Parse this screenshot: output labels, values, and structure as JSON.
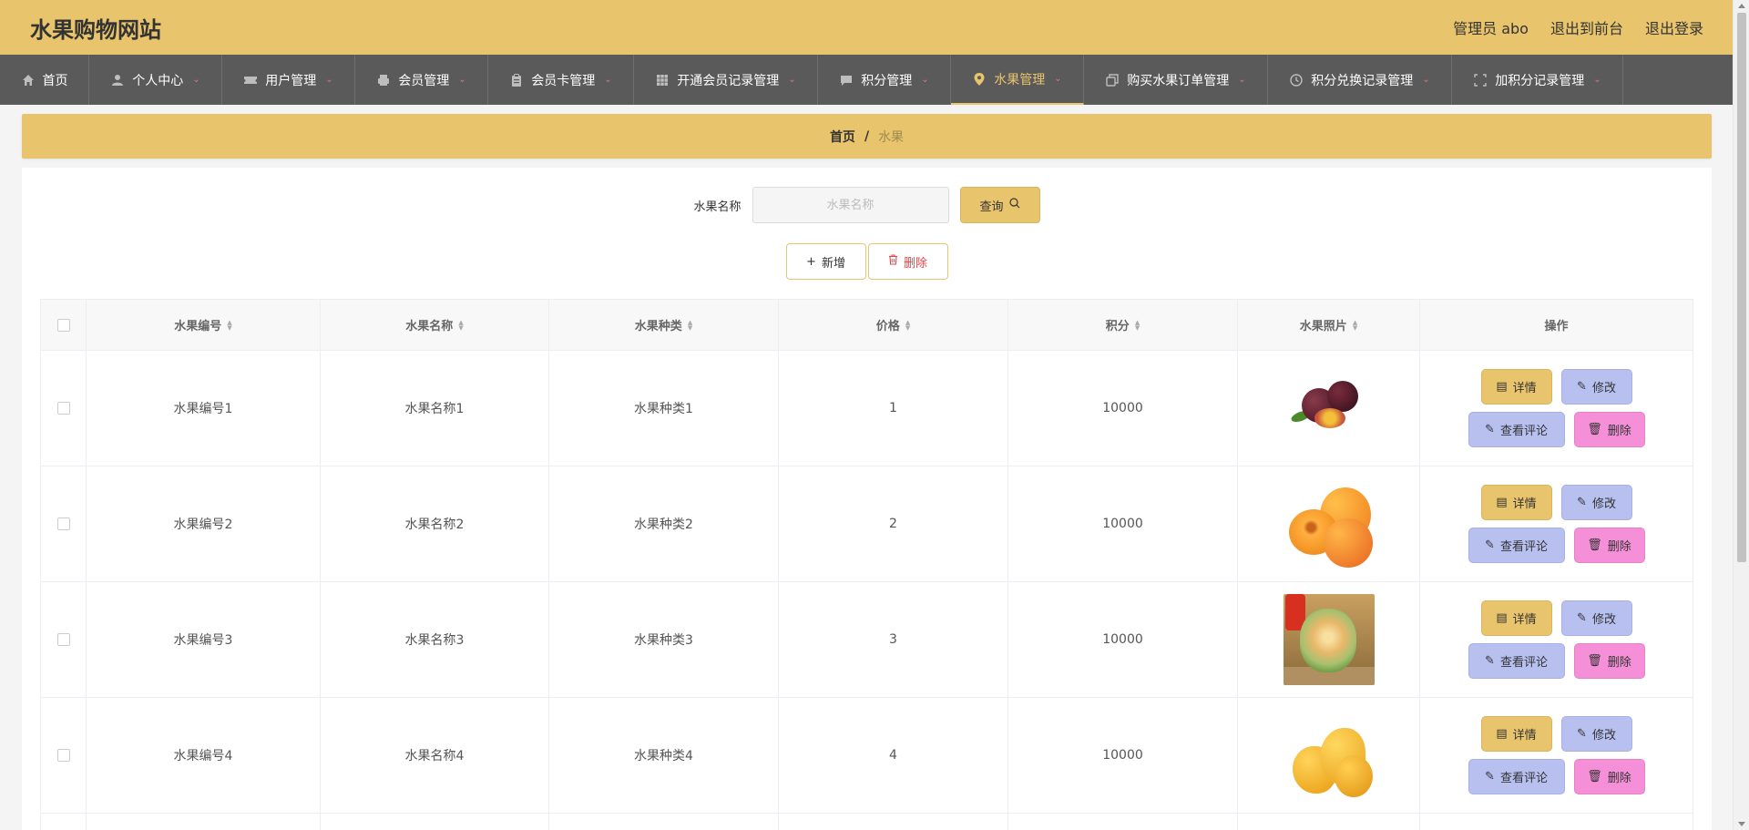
{
  "header": {
    "site_title": "水果购物网站",
    "admin_label": "管理员 abo",
    "to_front_label": "退出到前台",
    "logout_label": "退出登录"
  },
  "nav": {
    "items": [
      {
        "label": "首页",
        "icon": "home-icon",
        "has_dropdown": false
      },
      {
        "label": "个人中心",
        "icon": "person-icon",
        "has_dropdown": true
      },
      {
        "label": "用户管理",
        "icon": "ticket-icon",
        "has_dropdown": true
      },
      {
        "label": "会员管理",
        "icon": "printer-icon",
        "has_dropdown": true
      },
      {
        "label": "会员卡管理",
        "icon": "clipboard-icon",
        "has_dropdown": true
      },
      {
        "label": "开通会员记录管理",
        "icon": "grid-icon",
        "has_dropdown": true
      },
      {
        "label": "积分管理",
        "icon": "chat-icon",
        "has_dropdown": true
      },
      {
        "label": "水果管理",
        "icon": "location-icon",
        "has_dropdown": true,
        "active": true
      },
      {
        "label": "购买水果订单管理",
        "icon": "copy-icon",
        "has_dropdown": true
      },
      {
        "label": "积分兑换记录管理",
        "icon": "clock-icon",
        "has_dropdown": true
      },
      {
        "label": "加积分记录管理",
        "icon": "fullscreen-icon",
        "has_dropdown": true
      }
    ]
  },
  "breadcrumb": {
    "home": "首页",
    "separator": "/",
    "current": "水果"
  },
  "search": {
    "label": "水果名称",
    "placeholder": "水果名称",
    "value": "",
    "button_label": "查询"
  },
  "actions": {
    "add_label": "新增",
    "delete_label": "删除"
  },
  "table": {
    "headers": [
      "水果编号",
      "水果名称",
      "水果种类",
      "价格",
      "积分",
      "水果照片",
      "操作"
    ],
    "rows": [
      {
        "code": "水果编号1",
        "name": "水果名称1",
        "type": "水果种类1",
        "price": "1",
        "points": "10000",
        "photo": "passion-fruit-photo"
      },
      {
        "code": "水果编号2",
        "name": "水果名称2",
        "type": "水果种类2",
        "price": "2",
        "points": "10000",
        "photo": "apricot-photo"
      },
      {
        "code": "水果编号3",
        "name": "水果名称3",
        "type": "水果种类3",
        "price": "3",
        "points": "10000",
        "photo": "carved-melon-photo"
      },
      {
        "code": "水果编号4",
        "name": "水果名称4",
        "type": "水果种类4",
        "price": "4",
        "points": "10000",
        "photo": "mango-photo"
      }
    ],
    "op_labels": {
      "detail": "详情",
      "edit": "修改",
      "review": "查看评论",
      "delete": "删除"
    }
  },
  "colors": {
    "accent": "#e8c46c",
    "nav_bg": "#5a5a5a",
    "edit_btn": "#b8c0f0",
    "delete_btn": "#f590d8"
  }
}
